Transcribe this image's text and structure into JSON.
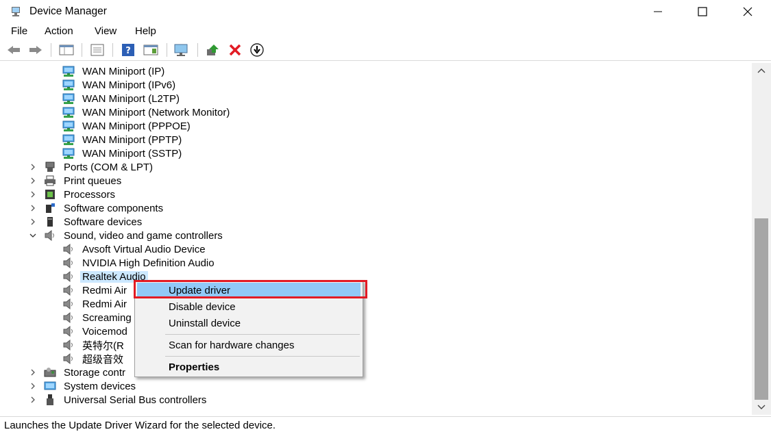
{
  "window": {
    "title": "Device Manager",
    "controls": {
      "minimize": "minimize",
      "maximize": "maximize",
      "close": "close"
    }
  },
  "menu": [
    "File",
    "Action",
    "View",
    "Help"
  ],
  "toolbar": {
    "buttons": [
      "back-icon",
      "forward-icon",
      "show-hide-tree-icon",
      "properties-icon",
      "help-icon",
      "action-pane-icon",
      "scan-hardware-icon",
      "update-driver-icon",
      "uninstall-icon",
      "disable-icon"
    ]
  },
  "tree": {
    "wan_items": [
      "WAN Miniport (IP)",
      "WAN Miniport (IPv6)",
      "WAN Miniport (L2TP)",
      "WAN Miniport (Network Monitor)",
      "WAN Miniport (PPPOE)",
      "WAN Miniport (PPTP)",
      "WAN Miniport (SSTP)"
    ],
    "categories_before": [
      "Ports (COM & LPT)",
      "Print queues",
      "Processors",
      "Software components",
      "Software devices"
    ],
    "sound_category": "Sound, video and game controllers",
    "sound_items": [
      "Avsoft Virtual Audio Device",
      "NVIDIA High Definition Audio",
      "Realtek Audio",
      "Redmi Air",
      "Redmi Air",
      "Screaming",
      "Voicemod",
      "英特尔(R",
      "超级音效"
    ],
    "categories_after": [
      "Storage contr",
      "System devices",
      "Universal Serial Bus controllers"
    ]
  },
  "context_menu": {
    "update": "Update driver",
    "disable": "Disable device",
    "uninstall": "Uninstall device",
    "scan": "Scan for hardware changes",
    "properties": "Properties"
  },
  "status": "Launches the Update Driver Wizard for the selected device.",
  "colors": {
    "highlight": "#91c9f7",
    "selection": "#cce8ff",
    "annotation": "#e21b24"
  }
}
